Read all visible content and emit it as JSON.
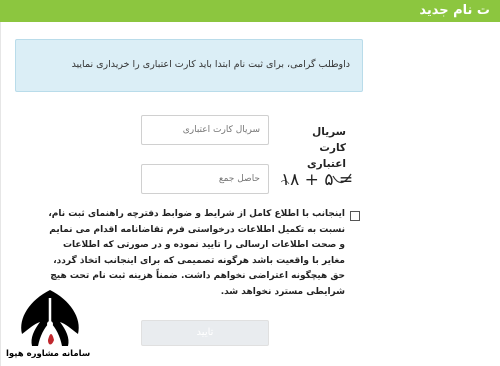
{
  "header": {
    "title": "ت نام جدید"
  },
  "info": {
    "message": "داوطلب گرامی، برای ثبت نام ابتدا باید کارت اعتباری را خریداری نمایید"
  },
  "form": {
    "serial": {
      "label": "سریال کارت اعتباری",
      "placeholder": "سریال کارت اعتباری",
      "value": ""
    },
    "captcha": {
      "expression": "۱۸ + ۵ =",
      "placeholder": "حاصل جمع",
      "value": ""
    },
    "agreement": {
      "checked": false,
      "text": "اینجانب با اطلاع کامل از شرایط و ضوابط دفترچه راهنمای ثبت نام، نسبت به تکمیل اطلاعات درخواستی فرم تقاضانامه اقدام می نمایم و صحت اطلاعات ارسالی را تایید نموده و در صورتی که اطلاعات مغایر با واقعیت باشد هرگونه تصمیمی که برای اینجانب اتخاذ گردد، حق هیچگونه اعتراضی نخواهم داشت. ضمناً هزینه ثبت نام تحت هیچ شرایطی مسترد نخواهد شد."
    },
    "submit_label": "تایید"
  },
  "logo": {
    "name": "سامانه مشاوره هپوا"
  }
}
